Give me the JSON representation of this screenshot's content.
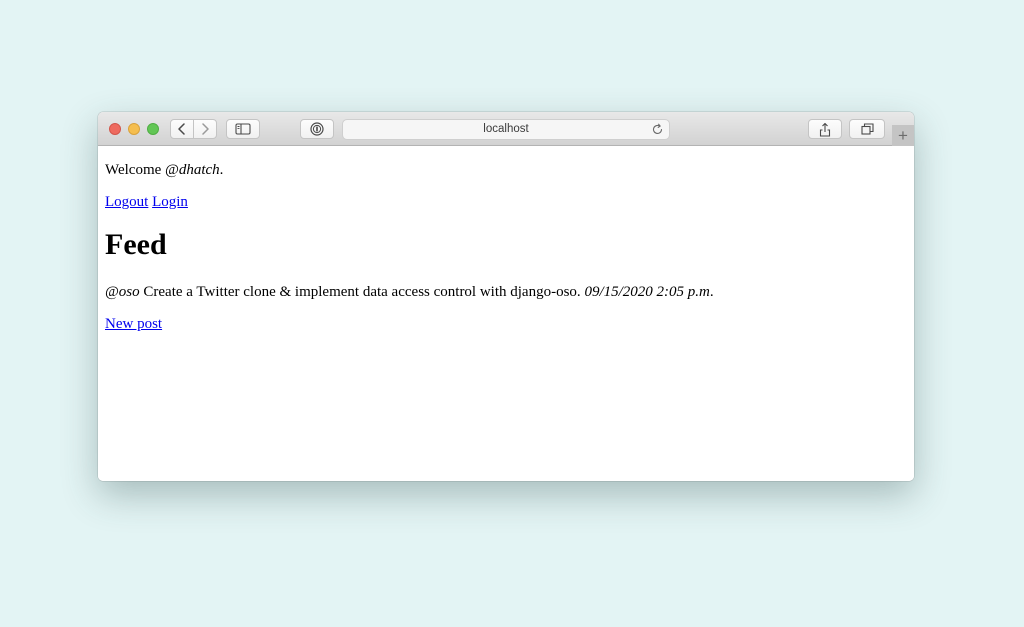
{
  "browser": {
    "address": "localhost",
    "icons": {
      "back": "chevron-left-icon",
      "forward": "chevron-right-icon",
      "sidebar": "sidebar-icon",
      "password": "password-manager-icon",
      "reload": "reload-icon",
      "share": "share-icon",
      "tabs": "tabs-overview-icon",
      "new_tab": "+"
    }
  },
  "page": {
    "welcome": {
      "prefix": "Welcome ",
      "username": "@dhatch",
      "suffix": "."
    },
    "links": {
      "logout": "Logout",
      "login": "Login"
    },
    "title": "Feed",
    "posts": [
      {
        "author": "@oso",
        "text": " Create a Twitter clone & implement data access control with django-oso. ",
        "timestamp": "09/15/2020 2:05 p.m",
        "end": "."
      }
    ],
    "new_post": "New post"
  }
}
